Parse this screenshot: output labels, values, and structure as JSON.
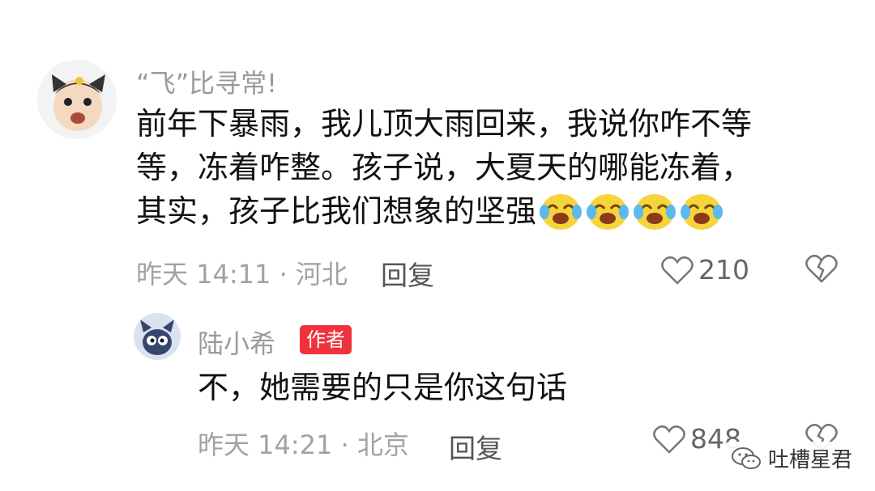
{
  "comment": {
    "username": "“飞”比寻常!",
    "text_lines": [
      "前年下暴雨，我儿顶大雨回来，我说你咋不等",
      "等，冻着咋整。孩子说，大夏天的哪能冻着，",
      "其实，孩子比我们想象的坚强"
    ],
    "emojis": [
      "crying-laughing-icon",
      "crying-laughing-icon",
      "crying-laughing-icon",
      "crying-laughing-icon"
    ],
    "time_location": "昨天 14:11 · 河北",
    "reply_label": "回复",
    "like_count": "210"
  },
  "reply": {
    "username": "陆小希",
    "badge": "作者",
    "text": "不，她需要的只是你这句话",
    "time_location": "昨天 14:21 · 北京",
    "reply_label": "回复",
    "like_count": "848"
  },
  "watermark": {
    "text": "吐槽星君"
  },
  "colors": {
    "badge": "#f0323c",
    "meta_gray": "#a2a2a2",
    "text_black": "#111111"
  }
}
